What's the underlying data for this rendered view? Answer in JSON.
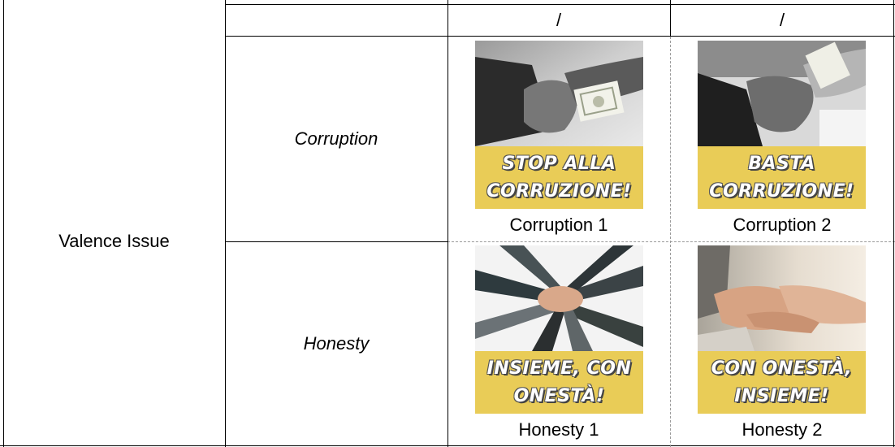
{
  "header": {
    "col3": "/",
    "col4": "/"
  },
  "rows": {
    "category": "Valence Issue",
    "corruption": {
      "label": "Corruption",
      "poster1": {
        "line1": "STOP ALLA",
        "line2": "CORRUZIONE!",
        "caption": "Corruption 1"
      },
      "poster2": {
        "line1": "BASTA",
        "line2": "CORRUZIONE!",
        "caption": "Corruption 2"
      }
    },
    "honesty": {
      "label": "Honesty",
      "poster1": {
        "line1": "INSIEME, CON",
        "line2": "ONESTÀ!",
        "caption": "Honesty 1"
      },
      "poster2": {
        "line1": "CON ONESTÀ,",
        "line2": "INSIEME!",
        "caption": "Honesty 2"
      }
    }
  },
  "colors": {
    "banner": "#e9cc57",
    "banner_text": "#ffffff"
  }
}
